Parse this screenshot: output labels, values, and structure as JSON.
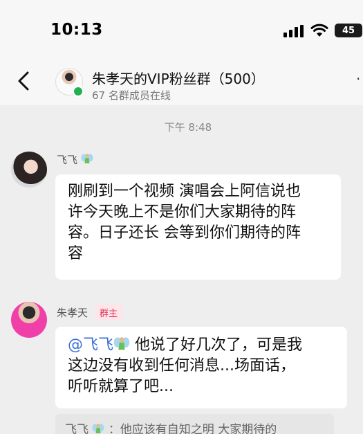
{
  "status_bar": {
    "time": "10:13",
    "battery": "45"
  },
  "header": {
    "title": "朱孝天的VIP粉丝群（500）",
    "subtitle": "67 名群成员在线",
    "more_mark": "·"
  },
  "chat": {
    "timestamp": "下午 8:48",
    "messages": [
      {
        "sender": "飞飞",
        "sender_emoji": "fairy-emoji",
        "lines": [
          "刚刷到一个视频 演唱会上阿信说也",
          "许今天晚上不是你们大家期待的阵",
          "容。日子还长 会等到你们期待的阵",
          "容"
        ]
      },
      {
        "sender": "朱孝天",
        "badge": "群主",
        "mention": "@飞飞",
        "line1_rest": " 他说了好几次了，可是我",
        "line2": "这边没有收到任何消息...场面话，",
        "line3": "听听就算了吧...",
        "quote_sender": "飞飞",
        "quote_text": "：他应该有自知之明 大家期待的"
      }
    ]
  },
  "colors": {
    "online": "#22b14c",
    "badge_bg": "#fde5ea",
    "badge_text": "#e23a5e",
    "mention": "#3a6fd8"
  }
}
